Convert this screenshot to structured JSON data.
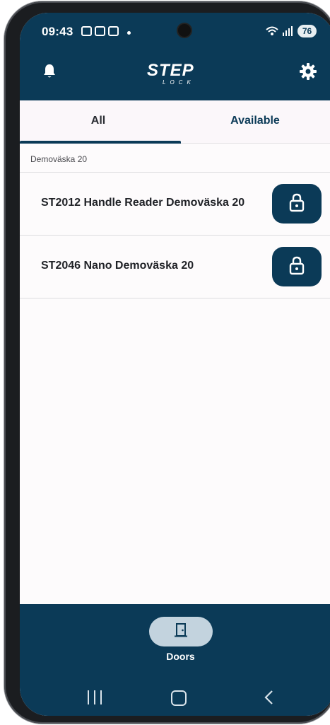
{
  "status_bar": {
    "time": "09:43",
    "battery": "76"
  },
  "app_bar": {
    "logo_main": "STEP",
    "logo_sub": "LOCK",
    "bell_icon": "bell-icon",
    "settings_icon": "gear-icon"
  },
  "tabs": [
    {
      "label": "All",
      "selected": true
    },
    {
      "label": "Available",
      "selected": false
    }
  ],
  "section": {
    "title": "Demoväska 20"
  },
  "doors": [
    {
      "name": "ST2012 Handle Reader Demoväska 20",
      "icon": "lock-open-icon"
    },
    {
      "name": "ST2046 Nano Demoväska 20",
      "icon": "lock-open-icon"
    }
  ],
  "bottom_nav": {
    "items": [
      {
        "label": "Doors",
        "icon": "door-icon",
        "selected": true
      }
    ]
  },
  "colors": {
    "primary": "#0b3a57",
    "nav_pill": "#c3d3de",
    "background": "#fdfbfc"
  }
}
